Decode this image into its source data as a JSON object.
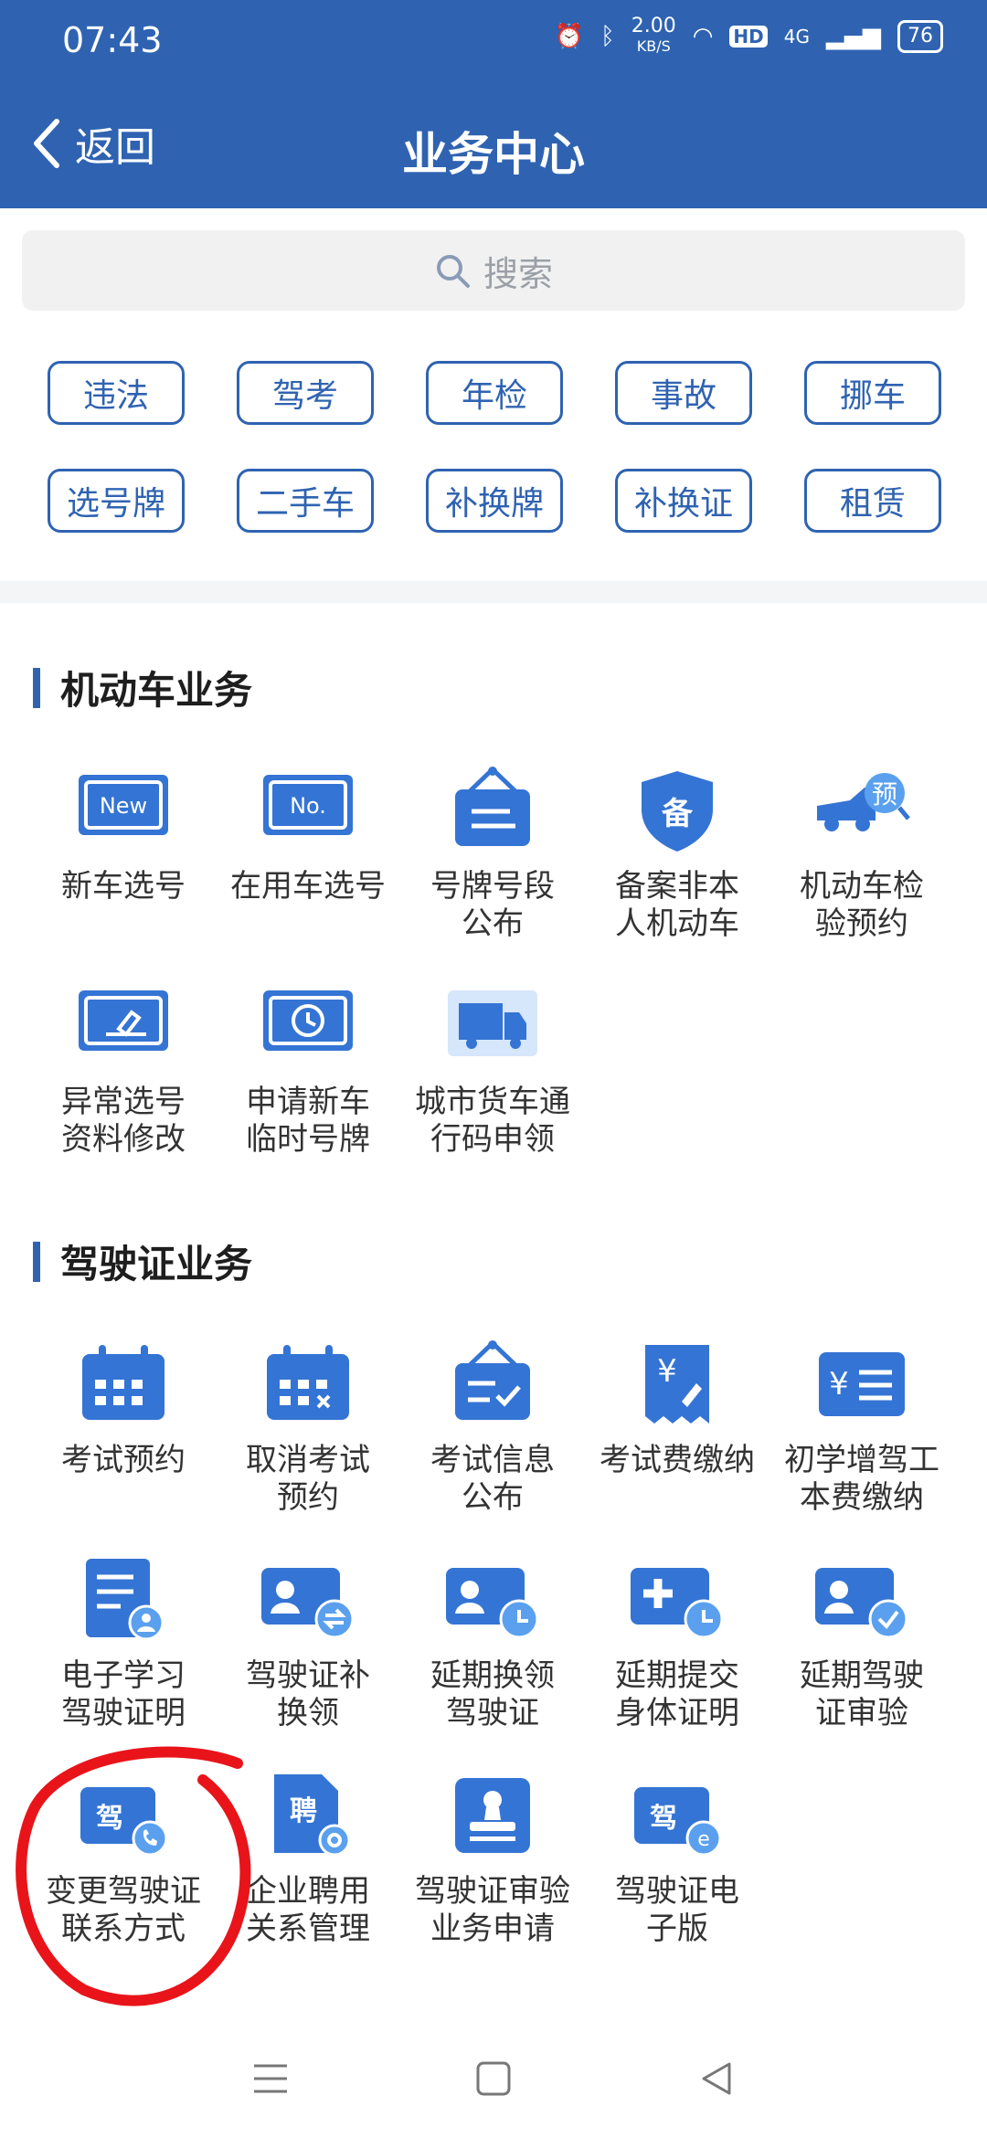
{
  "status_bar": {
    "time": "07:43",
    "speed": "2.00",
    "speed_unit": "KB/S",
    "network": "4G",
    "hd": "HD",
    "battery": "76"
  },
  "header": {
    "back_label": "返回",
    "title": "业务中心"
  },
  "search": {
    "placeholder": "搜索"
  },
  "quick_tags": [
    "违法",
    "驾考",
    "年检",
    "事故",
    "挪车",
    "选号牌",
    "二手车",
    "补换牌",
    "补换证",
    "租赁"
  ],
  "sections": [
    {
      "title": "机动车业务",
      "items": [
        {
          "label": "新车选号",
          "icon": "new-plate-icon"
        },
        {
          "label": "在用车选号",
          "icon": "number-plate-icon"
        },
        {
          "label": "号牌号段\n公布",
          "icon": "hanging-sign-icon"
        },
        {
          "label": "备案非本\n人机动车",
          "icon": "shield-record-icon"
        },
        {
          "label": "机动车检\n验预约",
          "icon": "truck-appointment-icon"
        },
        {
          "label": "异常选号\n资料修改",
          "icon": "edit-plate-icon"
        },
        {
          "label": "申请新车\n临时号牌",
          "icon": "clock-plate-icon"
        },
        {
          "label": "城市货车通\n行码申领",
          "icon": "cargo-truck-icon"
        }
      ]
    },
    {
      "title": "驾驶证业务",
      "items": [
        {
          "label": "考试预约",
          "icon": "calendar-icon"
        },
        {
          "label": "取消考试\n预约",
          "icon": "calendar-cancel-icon"
        },
        {
          "label": "考试信息\n公布",
          "icon": "hanging-check-icon"
        },
        {
          "label": "考试费缴纳",
          "icon": "yen-receipt-icon"
        },
        {
          "label": "初学增驾工\n本费缴纳",
          "icon": "yen-card-icon"
        },
        {
          "label": "电子学习\n驾驶证明",
          "icon": "document-user-icon"
        },
        {
          "label": "驾驶证补\n换领",
          "icon": "license-swap-icon"
        },
        {
          "label": "延期换领\n驾驶证",
          "icon": "license-clock-icon"
        },
        {
          "label": "延期提交\n身体证明",
          "icon": "medical-clock-icon"
        },
        {
          "label": "延期驾驶\n证审验",
          "icon": "license-check-icon"
        },
        {
          "label": "变更驾驶证\n联系方式",
          "icon": "license-phone-icon"
        },
        {
          "label": "企业聘用\n关系管理",
          "icon": "hire-gear-icon"
        },
        {
          "label": "驾驶证审验\n业务申请",
          "icon": "stamp-icon"
        },
        {
          "label": "驾驶证电\n子版",
          "icon": "license-e-icon"
        }
      ]
    }
  ],
  "colors": {
    "primary": "#2f63b1",
    "icon_dark": "#3474d4",
    "icon_light": "#5aa0ee",
    "annotation": "#e8141a"
  }
}
